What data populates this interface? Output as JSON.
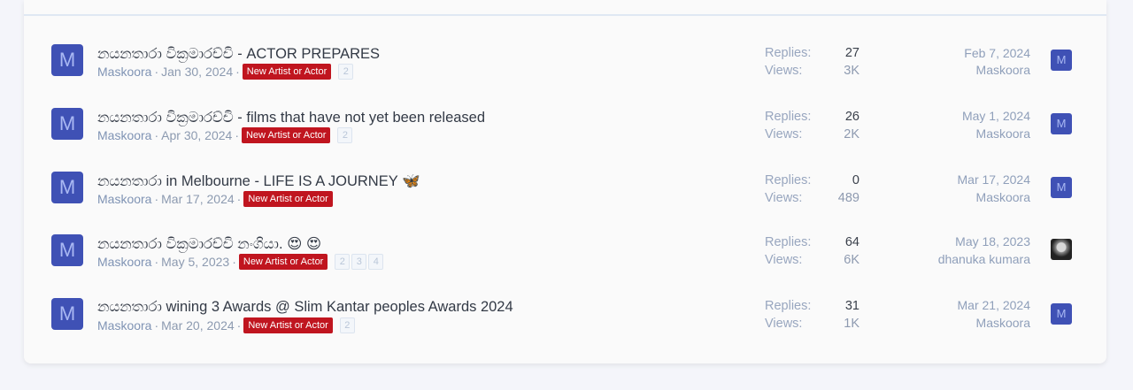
{
  "threads": [
    {
      "avatar_letter": "M",
      "title": "නයනතාරා වික්‍රමාරච්චි - ACTOR PREPARES",
      "author": "Maskoora",
      "date": "Jan 30, 2024",
      "prefix": "New Artist or Actor",
      "pages": [
        "2"
      ],
      "replies_label": "Replies:",
      "replies": "27",
      "views_label": "Views:",
      "views": "3K",
      "last_date": "Feb 7, 2024",
      "last_user": "Maskoora",
      "last_avatar_letter": "M"
    },
    {
      "avatar_letter": "M",
      "title": "නයනතාරා වික්‍රමාරච්චි - films that have not yet been released",
      "author": "Maskoora",
      "date": "Apr 30, 2024",
      "prefix": "New Artist or Actor",
      "pages": [
        "2"
      ],
      "replies_label": "Replies:",
      "replies": "26",
      "views_label": "Views:",
      "views": "2K",
      "last_date": "May 1, 2024",
      "last_user": "Maskoora",
      "last_avatar_letter": "M"
    },
    {
      "avatar_letter": "M",
      "title": "නයනතාරා in Melbourne - LIFE IS A JOURNEY 🦋",
      "author": "Maskoora",
      "date": "Mar 17, 2024",
      "prefix": "New Artist or Actor",
      "pages": [],
      "replies_label": "Replies:",
      "replies": "0",
      "views_label": "Views:",
      "views": "489",
      "last_date": "Mar 17, 2024",
      "last_user": "Maskoora",
      "last_avatar_letter": "M"
    },
    {
      "avatar_letter": "M",
      "title": "නයනතාරා වික්‍රමාරච්චි නංගියා. 😍 😍",
      "author": "Maskoora",
      "date": "May 5, 2023",
      "prefix": "New Artist or Actor",
      "pages": [
        "2",
        "3",
        "4"
      ],
      "replies_label": "Replies:",
      "replies": "64",
      "views_label": "Views:",
      "views": "6K",
      "last_date": "May 18, 2023",
      "last_user": "dhanuka kumara",
      "last_avatar_letter": ""
    },
    {
      "avatar_letter": "M",
      "title": "නයනතාරා wining 3 Awards @ Slim Kantar peoples Awards 2024",
      "author": "Maskoora",
      "date": "Mar 20, 2024",
      "prefix": "New Artist or Actor",
      "pages": [
        "2"
      ],
      "replies_label": "Replies:",
      "replies": "31",
      "views_label": "Views:",
      "views": "1K",
      "last_date": "Mar 21, 2024",
      "last_user": "Maskoora",
      "last_avatar_letter": "M"
    }
  ],
  "colors": {
    "avatar_bg": "#3f51b5",
    "prefix_bg": "#c0151f",
    "page_bg": "#f4f5fa"
  }
}
